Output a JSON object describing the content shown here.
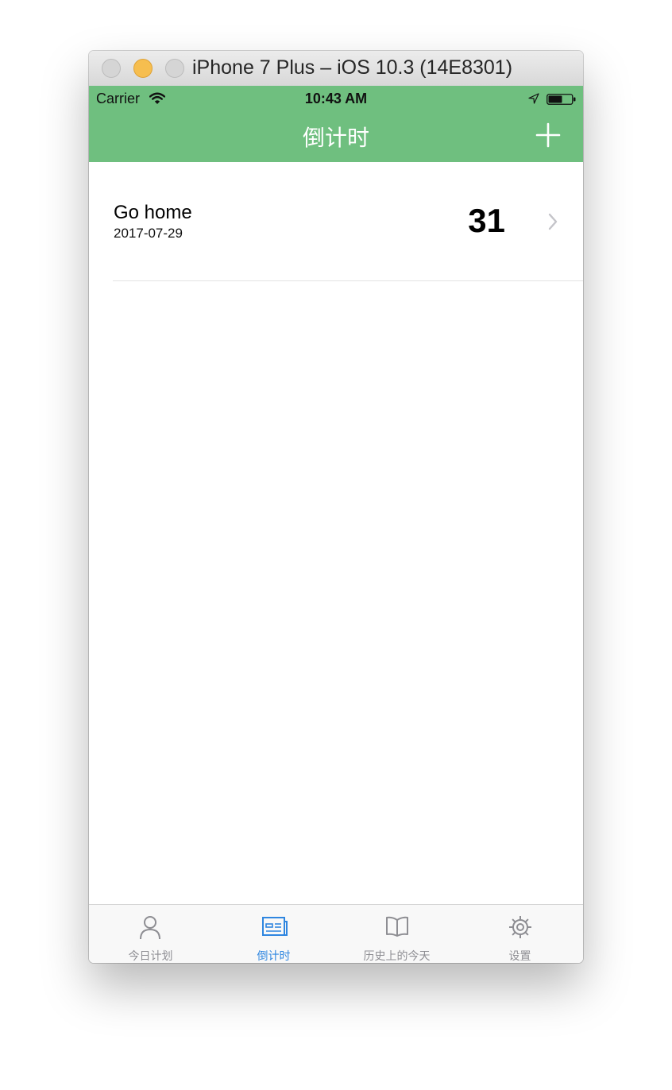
{
  "window": {
    "title": "iPhone 7 Plus – iOS 10.3 (14E8301)"
  },
  "status_bar": {
    "carrier": "Carrier",
    "time": "10:43 AM"
  },
  "nav": {
    "title": "倒计时",
    "accent_color": "#6fbf7f"
  },
  "list": {
    "items": [
      {
        "title": "Go home",
        "date": "2017-07-29",
        "days": "31"
      }
    ]
  },
  "tabbar": {
    "active_color": "#2f86e0",
    "tabs": [
      {
        "label": "今日计划",
        "icon": "person-icon"
      },
      {
        "label": "倒计时",
        "icon": "newspaper-icon"
      },
      {
        "label": "历史上的今天",
        "icon": "book-icon"
      },
      {
        "label": "设置",
        "icon": "gear-icon"
      }
    ]
  }
}
